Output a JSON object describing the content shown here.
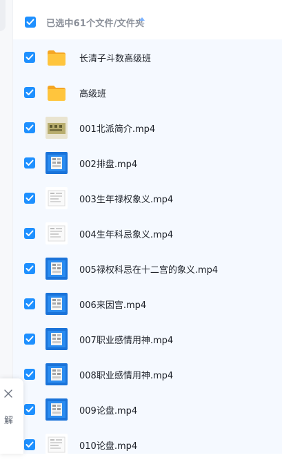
{
  "header": {
    "label": "已选中61个文件/文件夹"
  },
  "colors": {
    "accent": "#1e90ff",
    "folder": "#ffc53d",
    "row_bg": "#f5f9ff"
  },
  "files": [
    {
      "name": "长清子斗数高级班",
      "type": "folder",
      "checked": true
    },
    {
      "name": "高级班",
      "type": "folder",
      "checked": true
    },
    {
      "name": "001北派简介.mp4",
      "type": "video-yellow",
      "checked": true
    },
    {
      "name": "002排盘.mp4",
      "type": "video-blue",
      "checked": true
    },
    {
      "name": "003生年禄权象义.mp4",
      "type": "video-white",
      "checked": true
    },
    {
      "name": "004生年科忌象义.mp4",
      "type": "video-white",
      "checked": true
    },
    {
      "name": "005禄权科忌在十二宫的象义.mp4",
      "type": "video-blue",
      "checked": true
    },
    {
      "name": "006来因宫.mp4",
      "type": "video-blue",
      "checked": true
    },
    {
      "name": "007职业感情用神.mp4",
      "type": "video-blue",
      "checked": true
    },
    {
      "name": "008职业感情用神.mp4",
      "type": "video-blue",
      "checked": true
    },
    {
      "name": "009论盘.mp4",
      "type": "video-blue",
      "checked": true
    },
    {
      "name": "010论盘.mp4",
      "type": "video-white",
      "checked": true
    }
  ],
  "side_panel": {
    "label": "解"
  }
}
